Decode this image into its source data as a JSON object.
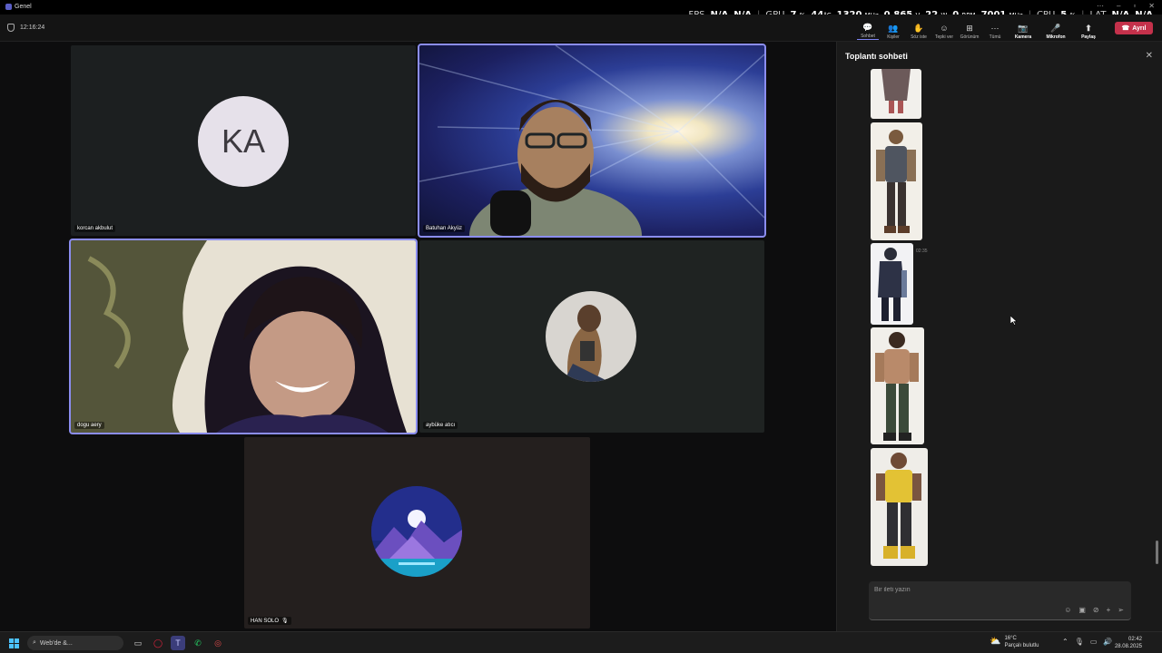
{
  "window": {
    "title": "Genel"
  },
  "osd": {
    "fps_label": "FPS",
    "fps_value": "N/A",
    "fps_value2": "N/A",
    "gpu_label": "GPU",
    "gpu_load": "7",
    "gpu_load_unit": "%",
    "gpu_temp": "44",
    "gpu_temp_unit": "°C",
    "gpu_clock": "1320",
    "gpu_clock_unit": "MHz",
    "gpu_volt": "0.865",
    "gpu_volt_unit": "V",
    "gpu_power": "22",
    "gpu_power_unit": "W",
    "fan": "0",
    "fan_unit": "RPM",
    "mem_clock": "7001",
    "mem_clock_unit": "MHz",
    "cpu_label": "CPU",
    "cpu_load": "5",
    "cpu_load_unit": "%",
    "lat_label": "LAT",
    "lat_value": "N/A",
    "lat_value2": "N/A"
  },
  "meeting": {
    "timer": "12:16:24"
  },
  "toolbar": {
    "chat": "Sohbet",
    "people": "Kişiler",
    "raise": "Söz iste",
    "react": "Tepki ver",
    "view": "Görünüm",
    "more": "Tümü",
    "camera": "Kamera",
    "mic": "Mikrofon",
    "share": "Paylaş",
    "leave": "Ayrıl"
  },
  "participants": {
    "p1": {
      "name": "korcan akbulut",
      "initials": "KA"
    },
    "p2": {
      "name": "Batuhan Akyüz"
    },
    "p3": {
      "name": "dogu aery"
    },
    "p4": {
      "name": "aybüke atıcı"
    },
    "p5": {
      "name": "HAN SOLO"
    }
  },
  "chat": {
    "title": "Toplantı sohbeti",
    "timestamp": "02:35",
    "placeholder": "Bir ileti yazın"
  },
  "taskbar": {
    "search": "Web'de &...",
    "weather_temp": "16°C",
    "weather_desc": "Parçalı bulutlu",
    "time": "02:42",
    "date": "28.08.2025"
  }
}
